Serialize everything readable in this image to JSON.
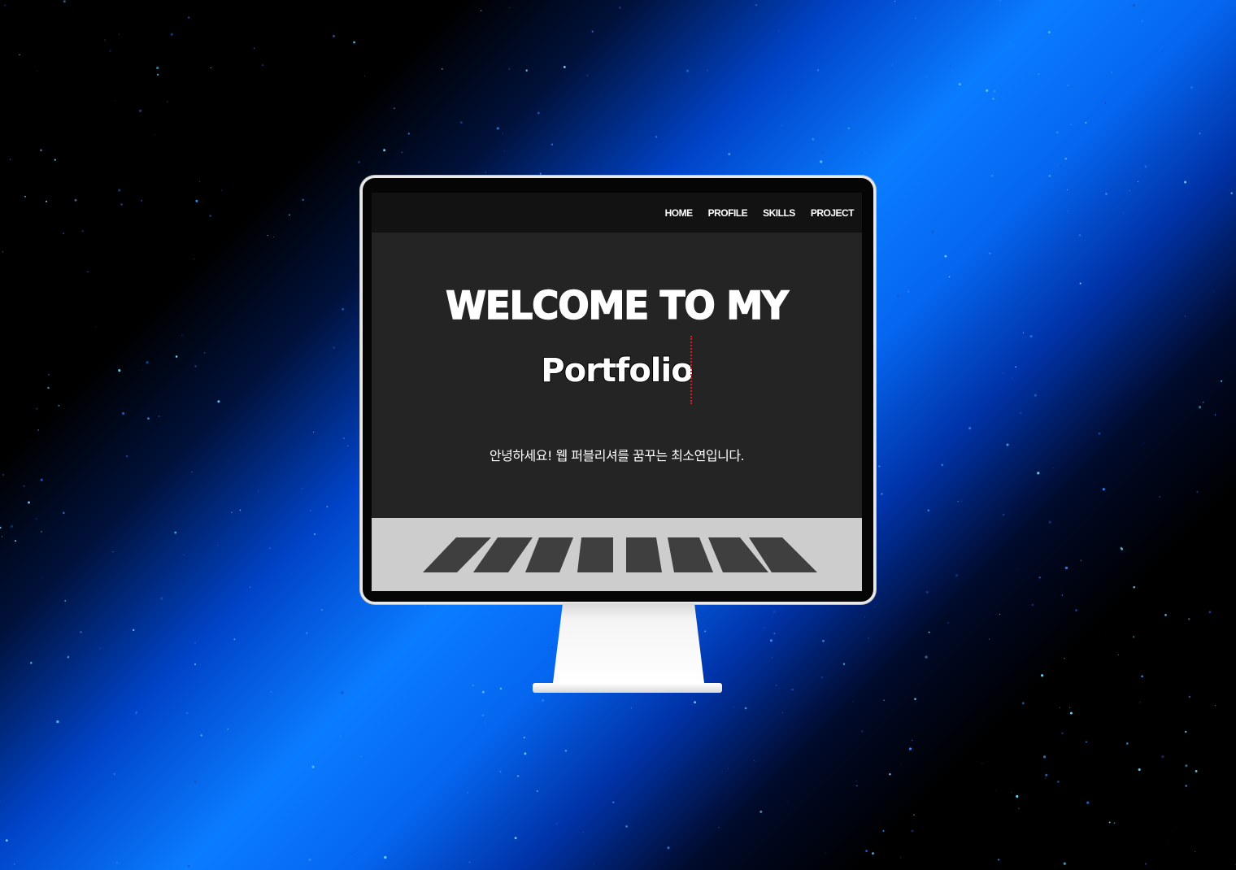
{
  "nav": {
    "items": [
      "HOME",
      "PROFILE",
      "SKILLS",
      "PROJECT"
    ]
  },
  "hero": {
    "title": "WELCOME TO MY",
    "subtitle": "Portfolio",
    "intro": "안녕하세요! 웹 퍼블리셔를 꿈꾸는 최소연입니다."
  },
  "colors": {
    "screen_bg": "#242424",
    "navbar_bg": "#121212",
    "accent_cursor": "#e01b1b",
    "crosswalk_bg": "#cdcdcd",
    "stripe": "#3f3f3f"
  }
}
